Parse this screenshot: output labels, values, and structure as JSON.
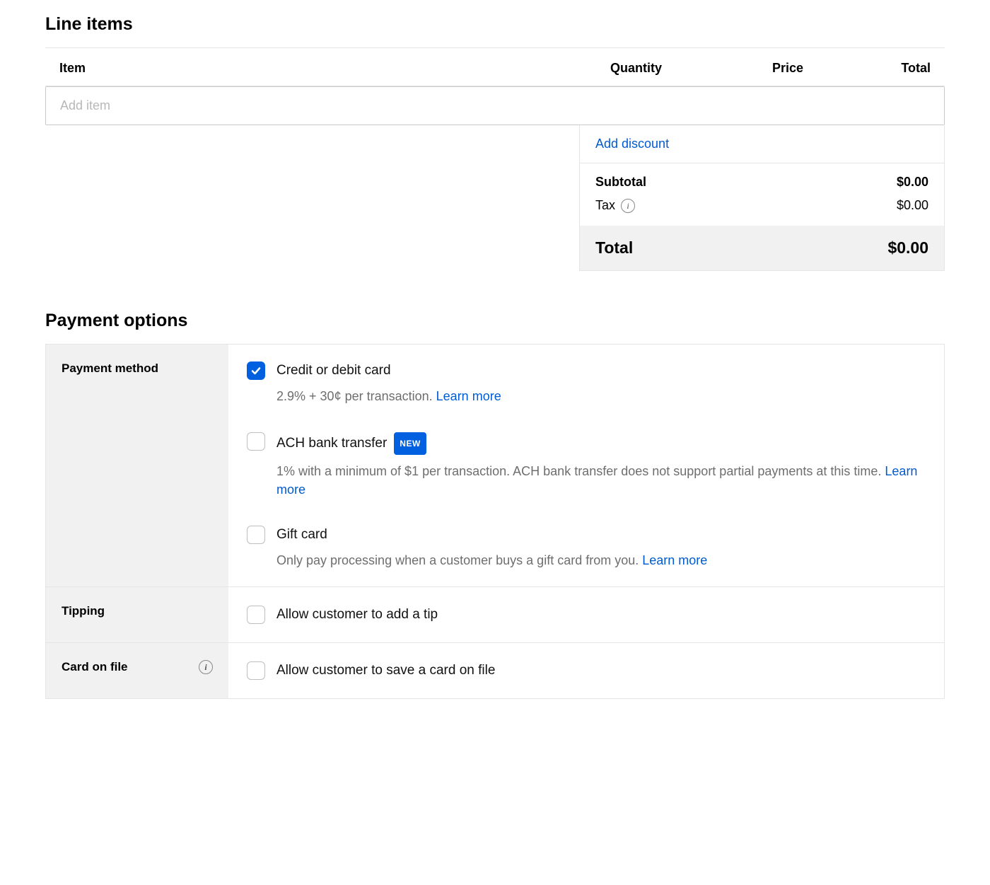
{
  "line_items": {
    "heading": "Line items",
    "columns": {
      "item": "Item",
      "quantity": "Quantity",
      "price": "Price",
      "total": "Total"
    },
    "add_item_placeholder": "Add item",
    "summary": {
      "add_discount": "Add discount",
      "subtotal_label": "Subtotal",
      "subtotal_value": "$0.00",
      "tax_label": "Tax",
      "tax_value": "$0.00",
      "total_label": "Total",
      "total_value": "$0.00"
    }
  },
  "payment": {
    "heading": "Payment options",
    "rows": {
      "method": {
        "label": "Payment method",
        "options": {
          "card": {
            "checked": true,
            "title": "Credit or debit card",
            "desc": "2.9% + 30¢ per transaction. ",
            "learn": "Learn more"
          },
          "ach": {
            "checked": false,
            "title": "ACH bank transfer",
            "badge": "NEW",
            "desc": "1% with a minimum of $1 per transaction. ACH bank transfer does not support partial payments at this time. ",
            "learn": "Learn more"
          },
          "gift": {
            "checked": false,
            "title": "Gift card",
            "desc": "Only pay processing when a customer buys a gift card from you. ",
            "learn": "Learn more"
          }
        }
      },
      "tipping": {
        "label": "Tipping",
        "option": {
          "checked": false,
          "title": "Allow customer to add a tip"
        }
      },
      "cof": {
        "label": "Card on file",
        "option": {
          "checked": false,
          "title": "Allow customer to save a card on file"
        }
      }
    }
  }
}
